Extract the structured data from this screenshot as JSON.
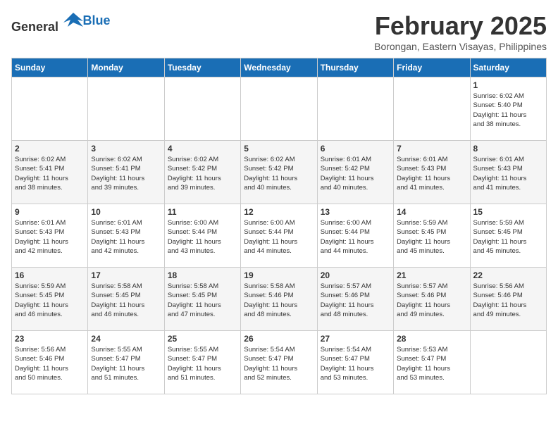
{
  "logo": {
    "general": "General",
    "blue": "Blue"
  },
  "title": "February 2025",
  "subtitle": "Borongan, Eastern Visayas, Philippines",
  "weekdays": [
    "Sunday",
    "Monday",
    "Tuesday",
    "Wednesday",
    "Thursday",
    "Friday",
    "Saturday"
  ],
  "weeks": [
    [
      {
        "day": "",
        "info": ""
      },
      {
        "day": "",
        "info": ""
      },
      {
        "day": "",
        "info": ""
      },
      {
        "day": "",
        "info": ""
      },
      {
        "day": "",
        "info": ""
      },
      {
        "day": "",
        "info": ""
      },
      {
        "day": "1",
        "info": "Sunrise: 6:02 AM\nSunset: 5:40 PM\nDaylight: 11 hours\nand 38 minutes."
      }
    ],
    [
      {
        "day": "2",
        "info": "Sunrise: 6:02 AM\nSunset: 5:41 PM\nDaylight: 11 hours\nand 38 minutes."
      },
      {
        "day": "3",
        "info": "Sunrise: 6:02 AM\nSunset: 5:41 PM\nDaylight: 11 hours\nand 39 minutes."
      },
      {
        "day": "4",
        "info": "Sunrise: 6:02 AM\nSunset: 5:42 PM\nDaylight: 11 hours\nand 39 minutes."
      },
      {
        "day": "5",
        "info": "Sunrise: 6:02 AM\nSunset: 5:42 PM\nDaylight: 11 hours\nand 40 minutes."
      },
      {
        "day": "6",
        "info": "Sunrise: 6:01 AM\nSunset: 5:42 PM\nDaylight: 11 hours\nand 40 minutes."
      },
      {
        "day": "7",
        "info": "Sunrise: 6:01 AM\nSunset: 5:43 PM\nDaylight: 11 hours\nand 41 minutes."
      },
      {
        "day": "8",
        "info": "Sunrise: 6:01 AM\nSunset: 5:43 PM\nDaylight: 11 hours\nand 41 minutes."
      }
    ],
    [
      {
        "day": "9",
        "info": "Sunrise: 6:01 AM\nSunset: 5:43 PM\nDaylight: 11 hours\nand 42 minutes."
      },
      {
        "day": "10",
        "info": "Sunrise: 6:01 AM\nSunset: 5:43 PM\nDaylight: 11 hours\nand 42 minutes."
      },
      {
        "day": "11",
        "info": "Sunrise: 6:00 AM\nSunset: 5:44 PM\nDaylight: 11 hours\nand 43 minutes."
      },
      {
        "day": "12",
        "info": "Sunrise: 6:00 AM\nSunset: 5:44 PM\nDaylight: 11 hours\nand 44 minutes."
      },
      {
        "day": "13",
        "info": "Sunrise: 6:00 AM\nSunset: 5:44 PM\nDaylight: 11 hours\nand 44 minutes."
      },
      {
        "day": "14",
        "info": "Sunrise: 5:59 AM\nSunset: 5:45 PM\nDaylight: 11 hours\nand 45 minutes."
      },
      {
        "day": "15",
        "info": "Sunrise: 5:59 AM\nSunset: 5:45 PM\nDaylight: 11 hours\nand 45 minutes."
      }
    ],
    [
      {
        "day": "16",
        "info": "Sunrise: 5:59 AM\nSunset: 5:45 PM\nDaylight: 11 hours\nand 46 minutes."
      },
      {
        "day": "17",
        "info": "Sunrise: 5:58 AM\nSunset: 5:45 PM\nDaylight: 11 hours\nand 46 minutes."
      },
      {
        "day": "18",
        "info": "Sunrise: 5:58 AM\nSunset: 5:45 PM\nDaylight: 11 hours\nand 47 minutes."
      },
      {
        "day": "19",
        "info": "Sunrise: 5:58 AM\nSunset: 5:46 PM\nDaylight: 11 hours\nand 48 minutes."
      },
      {
        "day": "20",
        "info": "Sunrise: 5:57 AM\nSunset: 5:46 PM\nDaylight: 11 hours\nand 48 minutes."
      },
      {
        "day": "21",
        "info": "Sunrise: 5:57 AM\nSunset: 5:46 PM\nDaylight: 11 hours\nand 49 minutes."
      },
      {
        "day": "22",
        "info": "Sunrise: 5:56 AM\nSunset: 5:46 PM\nDaylight: 11 hours\nand 49 minutes."
      }
    ],
    [
      {
        "day": "23",
        "info": "Sunrise: 5:56 AM\nSunset: 5:46 PM\nDaylight: 11 hours\nand 50 minutes."
      },
      {
        "day": "24",
        "info": "Sunrise: 5:55 AM\nSunset: 5:47 PM\nDaylight: 11 hours\nand 51 minutes."
      },
      {
        "day": "25",
        "info": "Sunrise: 5:55 AM\nSunset: 5:47 PM\nDaylight: 11 hours\nand 51 minutes."
      },
      {
        "day": "26",
        "info": "Sunrise: 5:54 AM\nSunset: 5:47 PM\nDaylight: 11 hours\nand 52 minutes."
      },
      {
        "day": "27",
        "info": "Sunrise: 5:54 AM\nSunset: 5:47 PM\nDaylight: 11 hours\nand 53 minutes."
      },
      {
        "day": "28",
        "info": "Sunrise: 5:53 AM\nSunset: 5:47 PM\nDaylight: 11 hours\nand 53 minutes."
      },
      {
        "day": "",
        "info": ""
      }
    ]
  ]
}
